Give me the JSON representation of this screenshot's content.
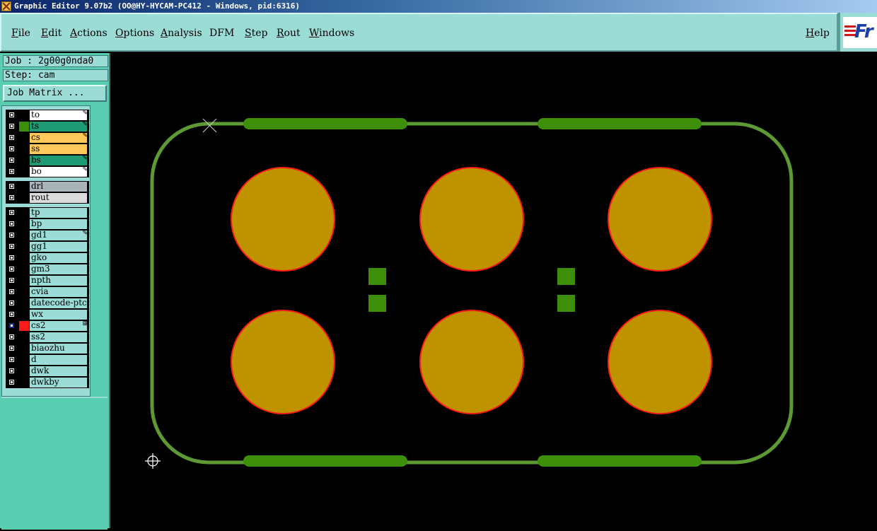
{
  "window": {
    "title": "Graphic Editor 9.07b2 (OO@HY-HYCAM-PC412 - Windows, pid:6316)"
  },
  "menu": {
    "items": [
      {
        "key": "F",
        "rest": "ile"
      },
      {
        "key": "E",
        "rest": "dit"
      },
      {
        "key": "A",
        "rest": "ctions"
      },
      {
        "key": "O",
        "rest": "ptions"
      },
      {
        "key": "A",
        "rest": "nalysis"
      },
      {
        "key": "D",
        "rest": "FM"
      },
      {
        "key": "S",
        "rest": "tep"
      },
      {
        "key": "R",
        "rest": "out"
      },
      {
        "key": "W",
        "rest": "indows"
      }
    ],
    "help": {
      "key": "H",
      "rest": "elp"
    }
  },
  "logo": {
    "text": "Fr"
  },
  "sidebar": {
    "job": "Job : 2g00g0nda0",
    "step": "Step: cam",
    "job_matrix": "Job Matrix ..."
  },
  "colors": {
    "board_outline": "#5e9a33",
    "pad_fill": "#bf9200",
    "pad_edge": "#ff1a1a",
    "smd": "#3d8f0a",
    "ui_panel": "#9bdcd6",
    "sidebar": "#58cdb0"
  },
  "layers": {
    "board": [
      {
        "name": "to",
        "bg": "#ffffff",
        "swatch": "#000000",
        "flag": "pencil-icon",
        "selected": false
      },
      {
        "name": "ts",
        "bg": "#1e9a74",
        "swatch": "#3d8f0a",
        "flag": "pencil-icon",
        "selected": false
      },
      {
        "name": "cs",
        "bg": "#ffc85a",
        "swatch": "#000000",
        "flag": "pencil-icon",
        "selected": false
      },
      {
        "name": "ss",
        "bg": "#ffc85a",
        "swatch": "#000000",
        "flag": "",
        "selected": false
      },
      {
        "name": "bs",
        "bg": "#1e9a74",
        "swatch": "#000000",
        "flag": "pencil-icon",
        "selected": false
      },
      {
        "name": "bo",
        "bg": "#ffffff",
        "swatch": "#000000",
        "flag": "pencil-icon",
        "selected": false
      }
    ],
    "drill": [
      {
        "name": "drl",
        "bg": "#a8b4b8",
        "swatch": "#000000",
        "flag": "",
        "selected": false
      },
      {
        "name": "rout",
        "bg": "#dcdcdc",
        "swatch": "#000000",
        "flag": "",
        "selected": false
      }
    ],
    "misc": [
      {
        "name": "tp",
        "bg": "#9bdcd6",
        "swatch": "#000000",
        "flag": "",
        "selected": false
      },
      {
        "name": "bp",
        "bg": "#9bdcd6",
        "swatch": "#000000",
        "flag": "",
        "selected": false
      },
      {
        "name": "gd1",
        "bg": "#9bdcd6",
        "swatch": "#000000",
        "flag": "pencil-icon",
        "selected": false
      },
      {
        "name": "gg1",
        "bg": "#9bdcd6",
        "swatch": "#000000",
        "flag": "",
        "selected": false
      },
      {
        "name": "gko",
        "bg": "#9bdcd6",
        "swatch": "#000000",
        "flag": "",
        "selected": false
      },
      {
        "name": "gm3",
        "bg": "#9bdcd6",
        "swatch": "#000000",
        "flag": "",
        "selected": false
      },
      {
        "name": "npth",
        "bg": "#9bdcd6",
        "swatch": "#000000",
        "flag": "",
        "selected": false
      },
      {
        "name": "cvia",
        "bg": "#9bdcd6",
        "swatch": "#000000",
        "flag": "",
        "selected": false
      },
      {
        "name": "datecode-ptc",
        "bg": "#9bdcd6",
        "swatch": "#000000",
        "flag": "",
        "selected": false
      },
      {
        "name": "wx",
        "bg": "#9bdcd6",
        "swatch": "#000000",
        "flag": "",
        "selected": false
      },
      {
        "name": "cs2",
        "bg": "#9bdcd6",
        "swatch": "#ff1a1a",
        "flag": "box-icon",
        "selected": true
      },
      {
        "name": "ss2",
        "bg": "#9bdcd6",
        "swatch": "#000000",
        "flag": "",
        "selected": false
      },
      {
        "name": "biaozhu",
        "bg": "#9bdcd6",
        "swatch": "#000000",
        "flag": "",
        "selected": false
      },
      {
        "name": "d",
        "bg": "#9bdcd6",
        "swatch": "#000000",
        "flag": "",
        "selected": false
      },
      {
        "name": "dwk",
        "bg": "#9bdcd6",
        "swatch": "#000000",
        "flag": "",
        "selected": false
      },
      {
        "name": "dwkby",
        "bg": "#9bdcd6",
        "swatch": "#000000",
        "flag": "",
        "selected": false
      }
    ]
  }
}
